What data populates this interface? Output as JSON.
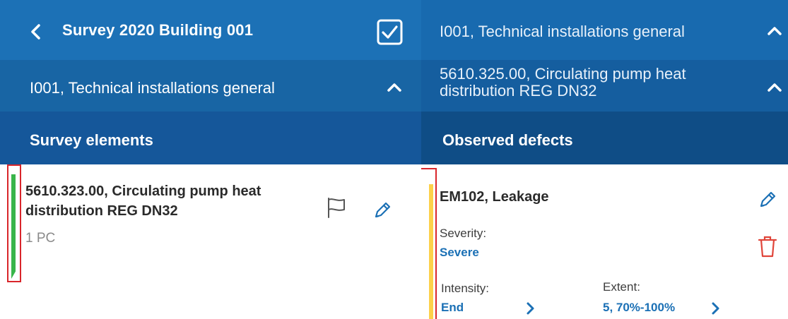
{
  "left": {
    "header_title": "Survey 2020 Building 001",
    "group_title": "I001, Technical installations general",
    "section_title": "Survey elements",
    "item": {
      "title": "5610.323.00, Circulating pump heat distribution REG DN32",
      "quantity": "1 PC",
      "status_color": "#39b54a"
    }
  },
  "right": {
    "group_title": "I001, Technical installations general",
    "element_title": "5610.325.00, Circulating pump heat distribution REG DN32",
    "section_title": "Observed defects",
    "defect": {
      "title": "EM102, Leakage",
      "severity_label": "Severity:",
      "severity_value": "Severe",
      "intensity_label": "Intensity:",
      "intensity_value": "End",
      "extent_label": "Extent:",
      "extent_value": "5, 70%-100%",
      "status_color": "#fdd14a"
    }
  },
  "icons": {
    "back": "chevron-left-icon",
    "checkbox": "checkbox-checked-icon",
    "collapse": "chevron-up-icon",
    "flag": "flag-icon",
    "edit": "pencil-icon",
    "delete": "trash-icon",
    "next": "chevron-right-icon"
  },
  "colors": {
    "primary": "#1c71b6",
    "accent_blue": "#1b70b5",
    "delete_red": "#e0453a",
    "highlight_red": "#d9262b"
  }
}
